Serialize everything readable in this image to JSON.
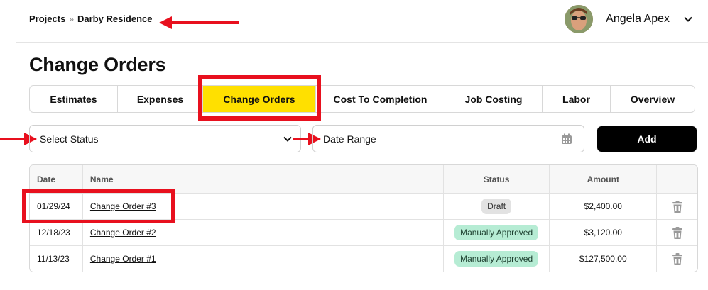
{
  "breadcrumb": {
    "root": "Projects",
    "separator": "»",
    "current": "Darby Residence"
  },
  "user": {
    "name": "Angela Apex"
  },
  "page": {
    "title": "Change Orders"
  },
  "tabs": [
    {
      "label": "Estimates",
      "active": false
    },
    {
      "label": "Expenses",
      "active": false
    },
    {
      "label": "Change Orders",
      "active": true
    },
    {
      "label": "Cost To Completion",
      "active": false
    },
    {
      "label": "Job Costing",
      "active": false
    },
    {
      "label": "Labor",
      "active": false
    },
    {
      "label": "Overview",
      "active": false
    }
  ],
  "filters": {
    "status_placeholder": "Select Status",
    "date_placeholder": "Date Range",
    "add_label": "Add"
  },
  "table": {
    "headers": [
      "Date",
      "Name",
      "Status",
      "Amount"
    ],
    "rows": [
      {
        "date": "01/29/24",
        "name": "Change Order #3",
        "status": "Draft",
        "amount": "$2,400.00"
      },
      {
        "date": "12/18/23",
        "name": "Change Order #2",
        "status": "Manually Approved",
        "amount": "$3,120.00"
      },
      {
        "date": "11/13/23",
        "name": "Change Order #1",
        "status": "Manually Approved",
        "amount": "$127,500.00"
      }
    ]
  },
  "colors": {
    "accent": "#ffe000",
    "annotation": "#e8101e",
    "approved": "#b6ecd4",
    "draft": "#e2e2e2"
  },
  "icons": [
    "chevron-down-icon",
    "calendar-icon",
    "trash-icon",
    "arrow-icon"
  ]
}
